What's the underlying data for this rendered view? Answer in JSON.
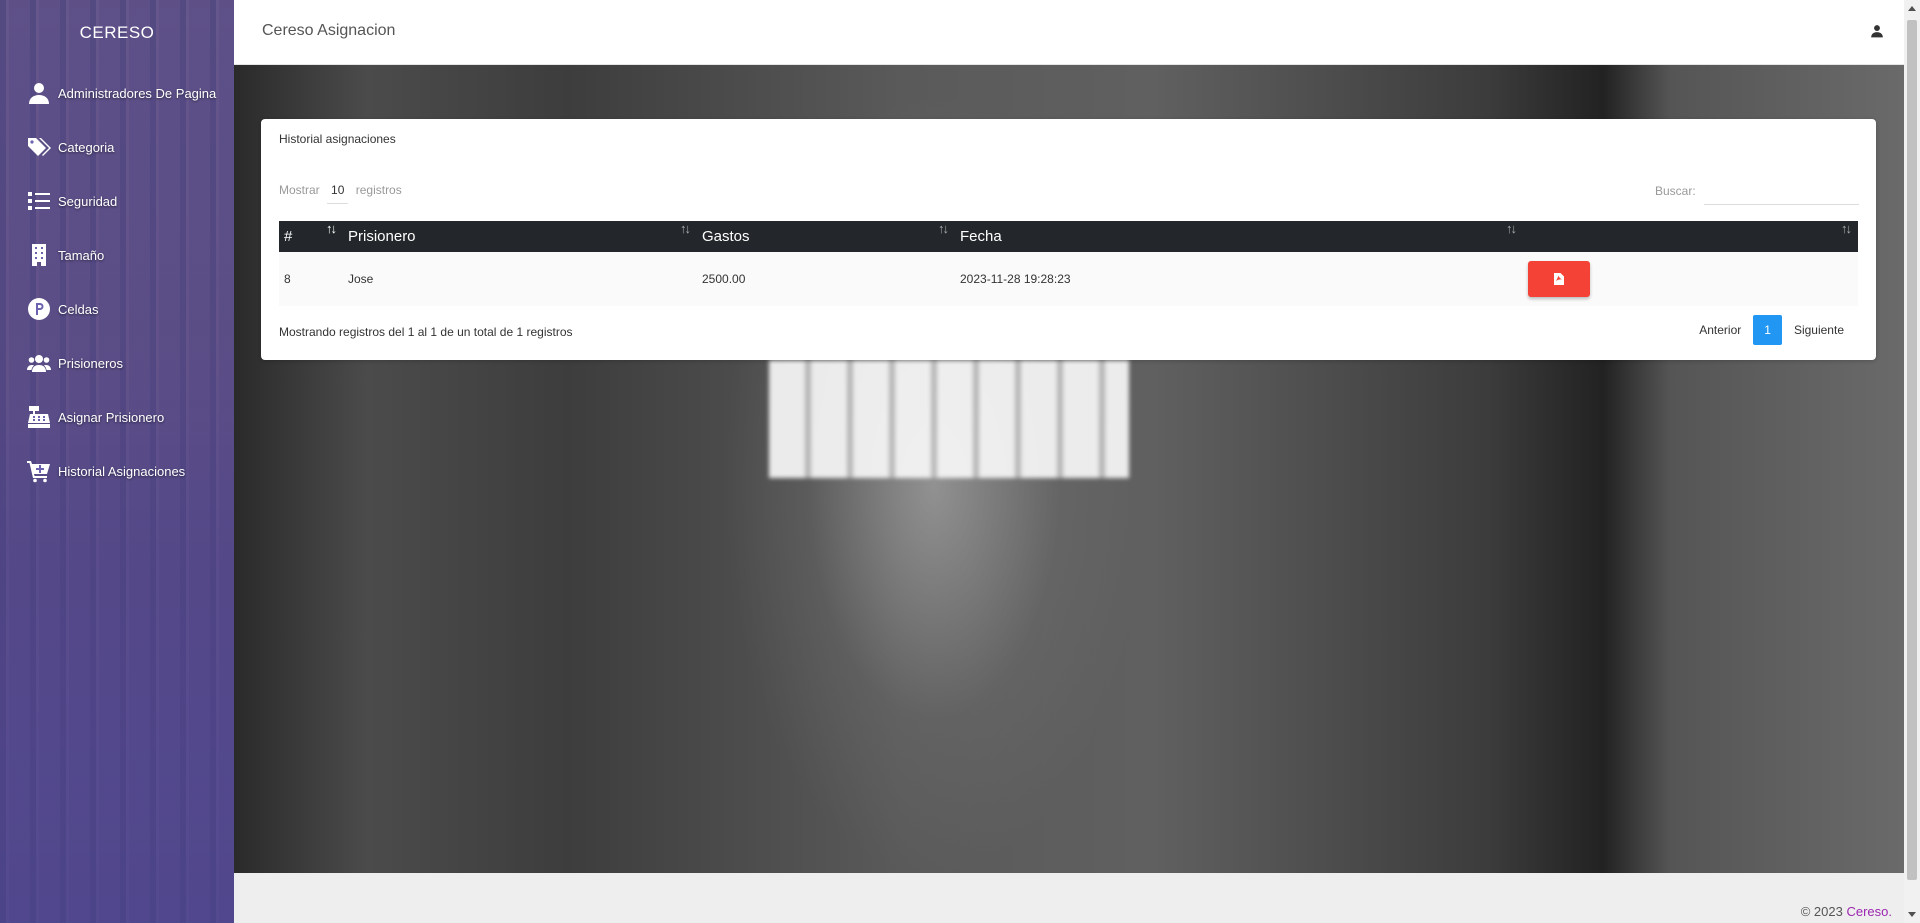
{
  "brand": "CERESO",
  "topbar": {
    "title": "Cereso Asignacion"
  },
  "sidebar": {
    "items": [
      {
        "label": "Administradores De Pagina",
        "icon": "user-icon"
      },
      {
        "label": "Categoria",
        "icon": "tags-icon"
      },
      {
        "label": "Seguridad",
        "icon": "list-icon"
      },
      {
        "label": "Tamaño",
        "icon": "building-icon"
      },
      {
        "label": "Celdas",
        "icon": "parking-icon"
      },
      {
        "label": "Prisioneros",
        "icon": "users-icon"
      },
      {
        "label": "Asignar Prisionero",
        "icon": "cash-register-icon"
      },
      {
        "label": "Historial Asignaciones",
        "icon": "cart-plus-icon"
      }
    ]
  },
  "card": {
    "title": "Historial asignaciones",
    "show_prefix": "Mostrar",
    "show_value": "10",
    "show_suffix": "registros",
    "search_label": "Buscar:",
    "search_value": "",
    "columns": [
      "#",
      "Prisionero",
      "Gastos",
      "Fecha",
      ""
    ],
    "rows": [
      {
        "id": "8",
        "prisionero": "Jose",
        "gastos": "2500.00",
        "fecha": "2023-11-28 19:28:23",
        "action_icon": "pdf-icon"
      }
    ],
    "info": "Mostrando registros del 1 al 1 de un total de 1 registros",
    "pager": {
      "prev": "Anterior",
      "current": "1",
      "next": "Siguiente"
    }
  },
  "footer": {
    "copyright": "© 2023",
    "brand": "Cereso."
  },
  "colors": {
    "pdf_button": "#f44336",
    "pager_active": "#2196f3",
    "table_header": "#23272b",
    "footer_brand": "#9c27b0"
  }
}
